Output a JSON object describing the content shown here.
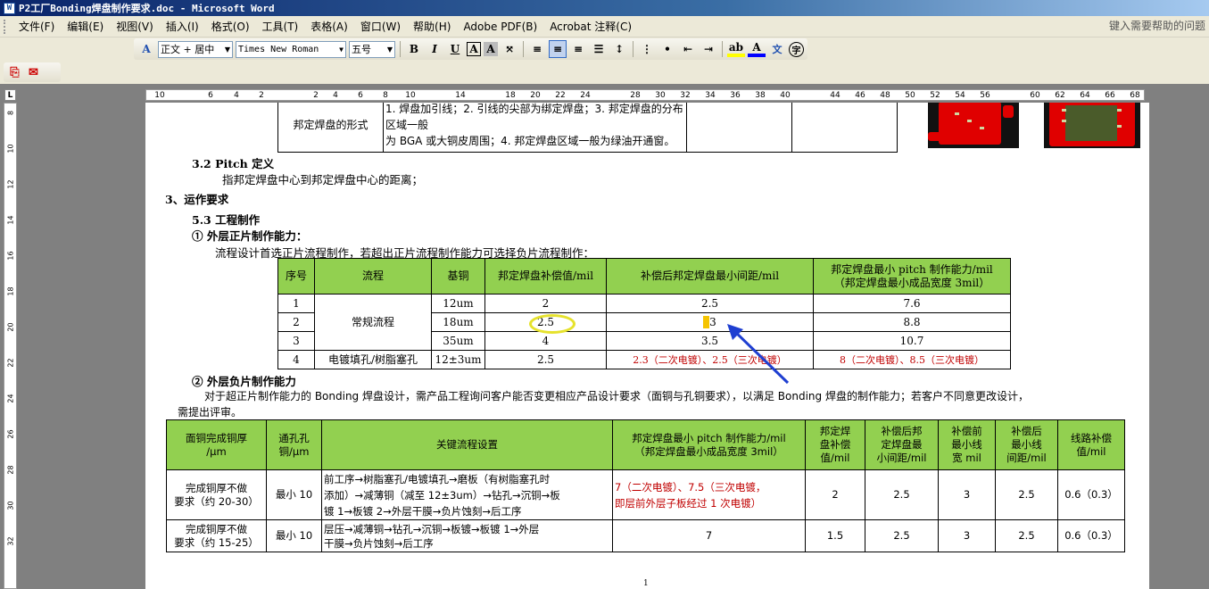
{
  "window": {
    "title": "P2工厂Bonding焊盘制作要求.doc - Microsoft Word",
    "icon": "word-doc-icon"
  },
  "menu": [
    "文件(F)",
    "编辑(E)",
    "视图(V)",
    "插入(I)",
    "格式(O)",
    "工具(T)",
    "表格(A)",
    "窗口(W)",
    "帮助(H)",
    "Adobe PDF(B)",
    "Acrobat 注释(C)"
  ],
  "help_box": "键入需要帮助的问题",
  "format_toolbar": {
    "style": "正文 + 居中",
    "font": "Times New Roman",
    "size": "五号",
    "bold": "B",
    "italic": "I",
    "underline": "U"
  },
  "ruler_h": [
    "10",
    "6",
    "4",
    "2",
    "2",
    "4",
    "6",
    "8",
    "10",
    "14",
    "18",
    "20",
    "22",
    "24",
    "28",
    "30",
    "32",
    "34",
    "36",
    "38",
    "40",
    "44",
    "46",
    "48",
    "50",
    "52",
    "54",
    "56",
    "60",
    "62",
    "64",
    "66",
    "68"
  ],
  "ruler_v": [
    "8",
    "10",
    "12",
    "14",
    "16",
    "18",
    "20",
    "22",
    "24",
    "26",
    "28",
    "30",
    "32"
  ],
  "doc": {
    "top_table": {
      "label": "邦定焊盘的形式",
      "line1": "1. 焊盘加引线；2. 引线的尖部为绑定焊盘；3. 邦定焊盘的分布区域一般",
      "line2": "为 BGA 或大铜皮周围；4. 邦定焊盘区域一般为绿油开通窗。"
    },
    "s32_title": "3.2 Pitch 定义",
    "s32_text": "指邦定焊盘中心到邦定焊盘中心的距离；",
    "s3_title": "3、运作要求",
    "s53_title": "5.3  工程制作",
    "sub1_title": "① 外层正片制作能力：",
    "sub1_text": "流程设计首选正片流程制作，若超出正片流程制作能力可选择负片流程制作：",
    "table1": {
      "headers": [
        "序号",
        "流程",
        "基铜",
        "邦定焊盘补偿值/mil",
        "补偿后邦定焊盘最小间距/mil",
        "邦定焊盘最小 pitch 制作能力/mil",
        "（邦定焊盘最小成品宽度 3mil）"
      ],
      "rows": [
        {
          "no": "1",
          "process": "",
          "base": "12um",
          "comp": "2",
          "gap": "2.5",
          "pitch": "7.6"
        },
        {
          "no": "2",
          "process": "常规流程",
          "base": "18um",
          "comp": "2.5",
          "gap": "3",
          "pitch": "8.8"
        },
        {
          "no": "3",
          "process": "",
          "base": "35um",
          "comp": "4",
          "gap": "3.5",
          "pitch": "10.7"
        },
        {
          "no": "4",
          "process": "电镀填孔/树脂塞孔",
          "base": "12±3um",
          "comp": "2.5",
          "gap": "2.3（二次电镀）、2.5（三次电镀）",
          "pitch": "8（二次电镀）、8.5（三次电镀）"
        }
      ]
    },
    "sub2_title": "② 外层负片制作能力",
    "sub2_text1": "对于超正片制作能力的 Bonding 焊盘设计，需产品工程询问客户能否变更相应产品设计要求（面铜与孔铜要求），以满足 Bonding 焊盘的制作能力；若客户不同意更改设计，",
    "sub2_text2": "需提出评审。",
    "table2": {
      "headers": {
        "h1a": "面铜完成铜厚",
        "h1b": "/μm",
        "h2a": "通孔孔",
        "h2b": "铜/μm",
        "h3": "关键流程设置",
        "h4a": "邦定焊盘最小 pitch 制作能力/mil",
        "h4b": "（邦定焊盘最小成品宽度 3mil）",
        "h5a": "邦定焊",
        "h5b": "盘补偿",
        "h5c": "值/mil",
        "h6a": "补偿后邦",
        "h6b": "定焊盘最",
        "h6c": "小间距/mil",
        "h7a": "补偿前",
        "h7b": "最小线",
        "h7c": "宽 mil",
        "h8a": "补偿后",
        "h8b": "最小线",
        "h8c": "间距/mil",
        "h9a": "线路补偿",
        "h9b": "值/mil"
      },
      "rows": [
        {
          "cu_a": "完成铜厚不做",
          "cu_b": "要求（约 20-30）",
          "hole": "最小 10",
          "flow1": "前工序→树脂塞孔/电镀填孔→磨板（有树脂塞孔时",
          "flow2": "添加）→减薄铜（减至 12±3um）→钻孔→沉铜→板",
          "flow3": "镀 1→板镀 2→外层干膜→负片蚀刻→后工序",
          "pitch1": "7（二次电镀）、7.5（三次电镀，",
          "pitch2": "即层前外层子板经过 1 次电镀）",
          "comp": "2",
          "gap": "2.5",
          "lw": "3",
          "ls": "2.5",
          "lc": "0.6（0.3）"
        },
        {
          "cu_a": "完成铜厚不做",
          "cu_b": "要求（约 15-25）",
          "hole": "最小 10",
          "flow1": "层压→减薄铜→钻孔→沉铜→板镀→板镀 1→外层",
          "flow2": "干膜→负片蚀刻→后工序",
          "flow3": "",
          "pitch1": "7",
          "pitch2": "",
          "comp": "1.5",
          "gap": "2.5",
          "lw": "3",
          "ls": "2.5",
          "lc": "0.6（0.3）"
        }
      ]
    },
    "page_num": "1"
  },
  "colors": {
    "header_green": "#92d050",
    "red_text": "#c00000",
    "annotation_yellow": "#e6e22c",
    "arrow_blue": "#1f3fd1"
  }
}
